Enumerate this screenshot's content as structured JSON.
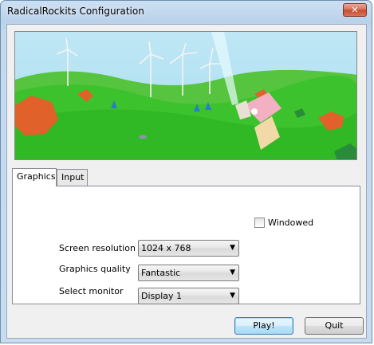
{
  "window": {
    "title": "RadicalRockits Configuration",
    "close_glyph": "✕"
  },
  "tabs": [
    {
      "label": "Graphics",
      "active": true
    },
    {
      "label": "Input",
      "active": false
    }
  ],
  "graphics": {
    "screen_resolution": {
      "label": "Screen resolution",
      "value": "1024 x 768"
    },
    "graphics_quality": {
      "label": "Graphics quality",
      "value": "Fantastic"
    },
    "select_monitor": {
      "label": "Select monitor",
      "value": "Display 1"
    },
    "windowed": {
      "label": "Windowed",
      "checked": false
    }
  },
  "buttons": {
    "play": "Play!",
    "quit": "Quit"
  },
  "colors": {
    "sky": "#a7dcef",
    "grass": "#33c02a",
    "accent": "#3c7fb1"
  },
  "icons": {
    "combo_arrow": "▼"
  }
}
